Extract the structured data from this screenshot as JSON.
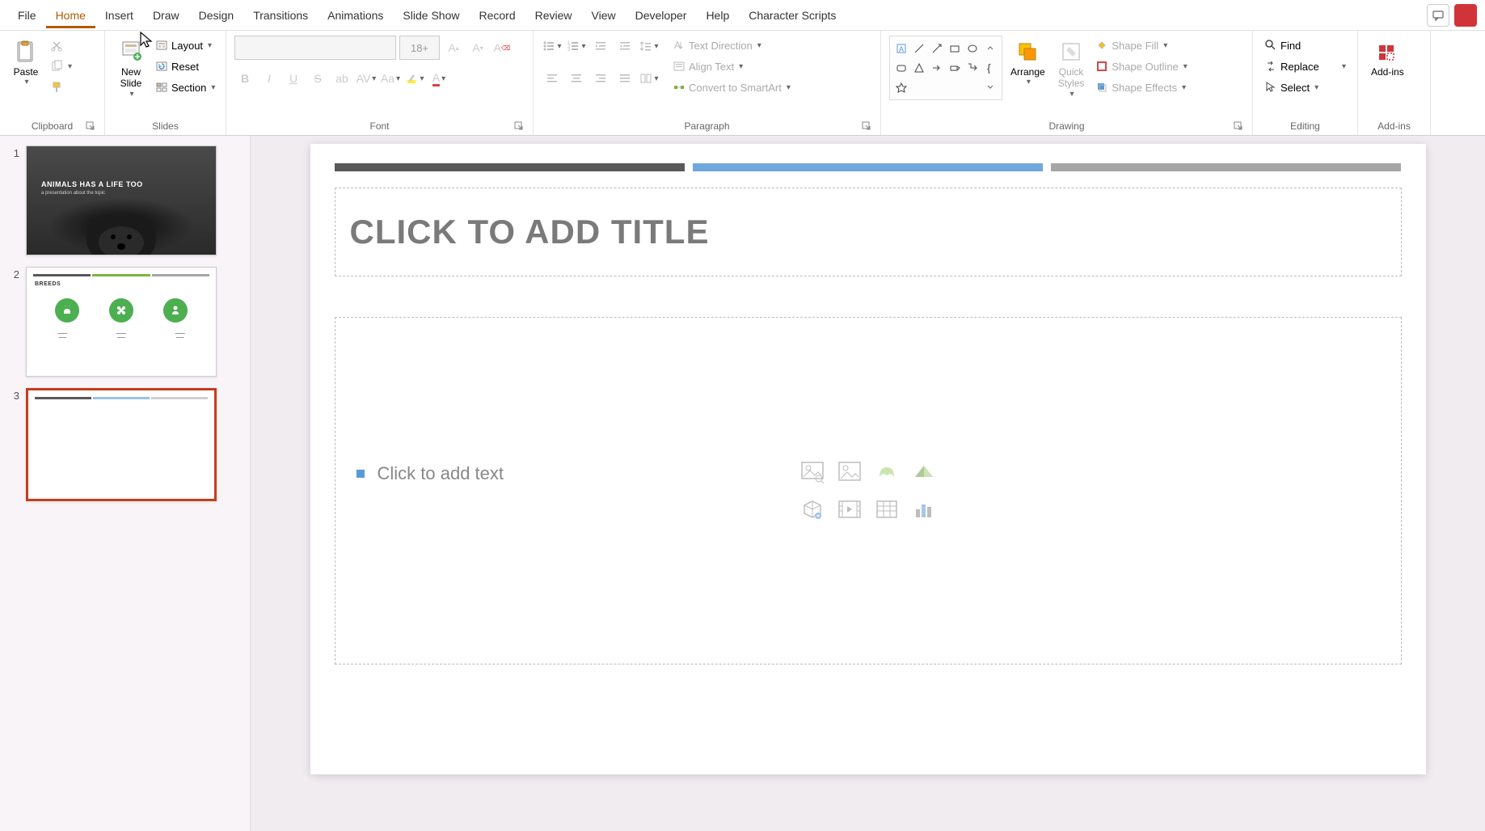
{
  "menu": {
    "tabs": [
      "File",
      "Home",
      "Insert",
      "Draw",
      "Design",
      "Transitions",
      "Animations",
      "Slide Show",
      "Record",
      "Review",
      "View",
      "Developer",
      "Help",
      "Character Scripts"
    ],
    "active_tab": "Home"
  },
  "ribbon": {
    "clipboard": {
      "label": "Clipboard",
      "paste": "Paste"
    },
    "slides": {
      "label": "Slides",
      "new_slide": "New\nSlide",
      "layout": "Layout",
      "reset": "Reset",
      "section": "Section"
    },
    "font": {
      "label": "Font",
      "size": "18+"
    },
    "paragraph": {
      "label": "Paragraph",
      "text_direction": "Text Direction",
      "align_text": "Align Text",
      "convert_smartart": "Convert to SmartArt"
    },
    "drawing": {
      "label": "Drawing",
      "arrange": "Arrange",
      "quick_styles": "Quick\nStyles",
      "shape_fill": "Shape Fill",
      "shape_outline": "Shape Outline",
      "shape_effects": "Shape Effects"
    },
    "editing": {
      "label": "Editing",
      "find": "Find",
      "replace": "Replace",
      "select": "Select"
    },
    "addins": {
      "label": "Add-ins",
      "btn": "Add-ins"
    }
  },
  "slides": {
    "items": [
      {
        "num": "1",
        "title": "ANIMALS HAS A LIFE TOO",
        "subtitle": "a presentation about the topic"
      },
      {
        "num": "2",
        "title": "BREEDS"
      },
      {
        "num": "3"
      }
    ]
  },
  "canvas": {
    "title_placeholder": "CLICK TO ADD TITLE",
    "text_placeholder": "Click to add text"
  },
  "colors": {
    "bar_dark": "#595959",
    "bar_blue": "#5b9bd5",
    "bar_gray": "#a6a6a6",
    "green": "#4caf50",
    "accent": "#c43e1c"
  }
}
